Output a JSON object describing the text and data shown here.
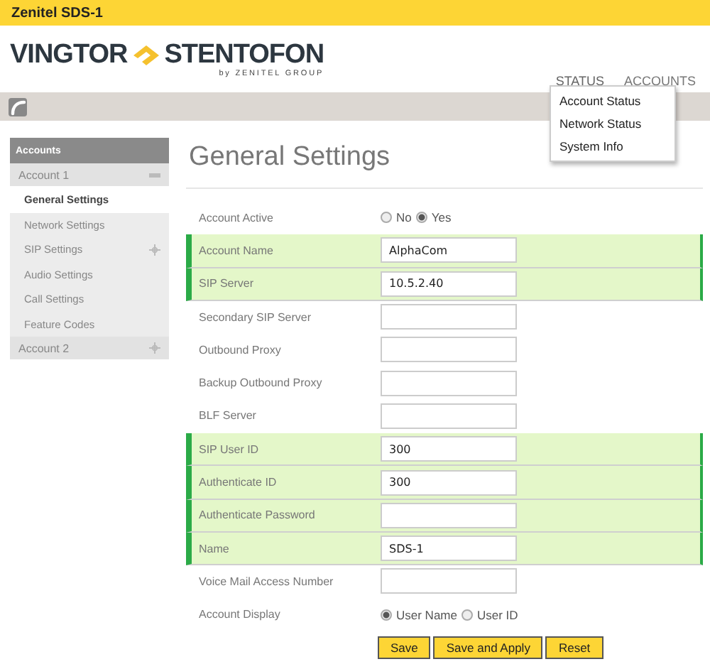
{
  "window": {
    "title": "Zenitel SDS-1"
  },
  "logo": {
    "left": "VINGTOR",
    "right": "STENTOFON",
    "tagline": "by ZENITEL GROUP"
  },
  "nav": [
    {
      "label": "STATUS",
      "expanded": true
    },
    {
      "label": "ACCOUNTS",
      "expanded": false
    }
  ],
  "status_menu": [
    "Account Status",
    "Network Status",
    "System Info"
  ],
  "sidebar": {
    "title": "Accounts",
    "groups": [
      {
        "label": "Account 1",
        "expanded": true,
        "items": [
          {
            "label": "General Settings",
            "selected": true,
            "has_children": false
          },
          {
            "label": "Network Settings",
            "selected": false,
            "has_children": false
          },
          {
            "label": "SIP Settings",
            "selected": false,
            "has_children": true
          },
          {
            "label": "Audio Settings",
            "selected": false,
            "has_children": false
          },
          {
            "label": "Call Settings",
            "selected": false,
            "has_children": false
          },
          {
            "label": "Feature Codes",
            "selected": false,
            "has_children": false
          }
        ]
      },
      {
        "label": "Account 2",
        "expanded": false
      }
    ]
  },
  "page_title": "General Settings",
  "rows": [
    {
      "kind": "radio",
      "label": "Account Active",
      "highlighted": false,
      "options": [
        {
          "label": "No",
          "selected": false
        },
        {
          "label": "Yes",
          "selected": true
        }
      ]
    },
    {
      "kind": "text",
      "label": "Account Name",
      "highlighted": true,
      "value": "AlphaCom"
    },
    {
      "kind": "text",
      "label": "SIP Server",
      "highlighted": true,
      "value": "10.5.2.40"
    },
    {
      "kind": "text",
      "label": "Secondary SIP Server",
      "highlighted": false
    },
    {
      "kind": "text",
      "label": "Outbound Proxy",
      "highlighted": false
    },
    {
      "kind": "text",
      "label": "Backup Outbound Proxy",
      "highlighted": false
    },
    {
      "kind": "text",
      "label": "BLF Server",
      "highlighted": false
    },
    {
      "kind": "text",
      "label": "SIP User ID",
      "highlighted": true,
      "value": "300"
    },
    {
      "kind": "text",
      "label": "Authenticate ID",
      "highlighted": true,
      "value": "300"
    },
    {
      "kind": "text",
      "label": "Authenticate Password",
      "highlighted": true
    },
    {
      "kind": "text",
      "label": "Name",
      "highlighted": true,
      "value": "SDS-1"
    },
    {
      "kind": "text",
      "label": "Voice Mail Access Number",
      "highlighted": false
    },
    {
      "kind": "radio",
      "label": "Account Display",
      "highlighted": false,
      "options": [
        {
          "label": "User Name",
          "selected": true
        },
        {
          "label": "User ID",
          "selected": false
        }
      ]
    }
  ],
  "buttons": [
    "Save",
    "Save and Apply",
    "Reset"
  ]
}
